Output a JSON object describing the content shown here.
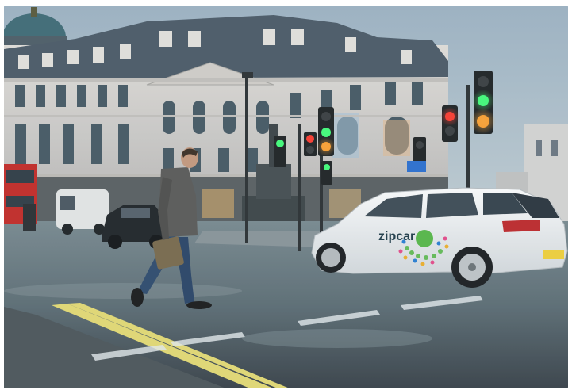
{
  "scene": {
    "car_brand_text": "zipcar",
    "plate_text": "",
    "palette": {
      "sky": "#9fb4c4",
      "building": "#d9d6d2",
      "road": "#6e7e86",
      "car": "#f2f3f2",
      "zipcar_green": "#57b947",
      "jacket": "#5b5a57",
      "jeans": "#2e4a6d",
      "bus_red": "#c62a25",
      "signal_red": "#ff3b2e",
      "signal_amber": "#ff9d2a",
      "signal_green": "#43ff7a"
    }
  }
}
